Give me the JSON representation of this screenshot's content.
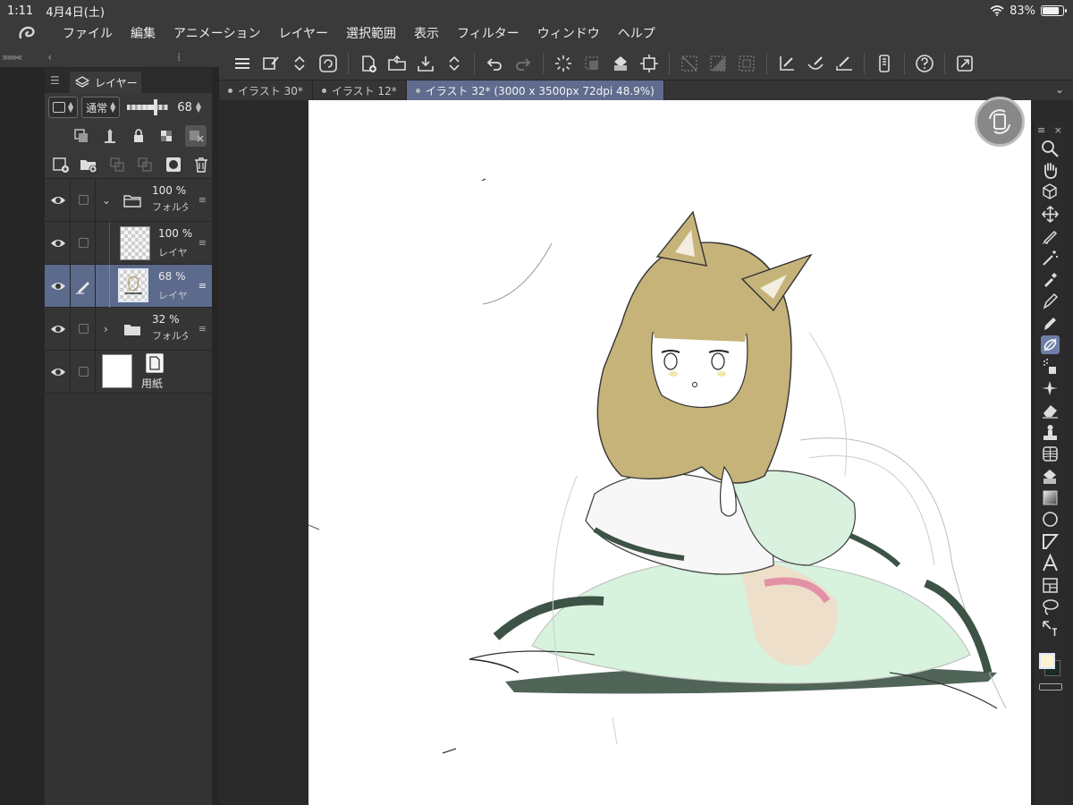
{
  "status_bar": {
    "time": "1:11",
    "date": "4月4日(土)",
    "battery": "83%",
    "battery_level": 0.83
  },
  "menu": {
    "items": [
      "ファイル",
      "編集",
      "アニメーション",
      "レイヤー",
      "選択範囲",
      "表示",
      "フィルター",
      "ウィンドウ",
      "ヘルプ"
    ]
  },
  "left_strip": {
    "arrows": "»»»«"
  },
  "layer_panel": {
    "tab_label": "レイヤー",
    "blend_mode": "通常",
    "opacity": "68",
    "opacity_level": 0.68,
    "layers": [
      {
        "percent": "100 %",
        "name": "フォルダ",
        "kind": "folder-open"
      },
      {
        "percent": "100 %",
        "name": "レイヤー",
        "kind": "raster"
      },
      {
        "percent": "68 %",
        "name": "レイヤー",
        "kind": "raster-selected"
      },
      {
        "percent": "32 %",
        "name": "フォルダ",
        "kind": "folder-closed"
      },
      {
        "percent": "",
        "name": "用紙",
        "kind": "paper"
      }
    ]
  },
  "doc_tabs": [
    {
      "label": "イラスト 30*"
    },
    {
      "label": "イラスト 12*"
    },
    {
      "label": "イラスト 32* (3000 x 3500px 72dpi 48.9%)"
    }
  ],
  "colors": {
    "main_color": "#fbf3d2",
    "sub_color": "#1b2a22",
    "selection": "#5c6a8c",
    "accent_tab": "#5f6c8e"
  },
  "tools": [
    "zoom-icon",
    "hand-icon",
    "object-icon",
    "move-icon",
    "marker-icon",
    "wand-icon",
    "eyedropper-icon",
    "pen-icon",
    "pencil-icon",
    "brush-icon",
    "airbrush-icon",
    "decoration-icon",
    "eraser-icon",
    "blend-icon",
    "mesh-icon",
    "fill-icon",
    "gradient-icon",
    "ellipse-icon",
    "frame-icon",
    "text-icon",
    "balloon-icon",
    "lasso-icon",
    "ruler-icon"
  ]
}
